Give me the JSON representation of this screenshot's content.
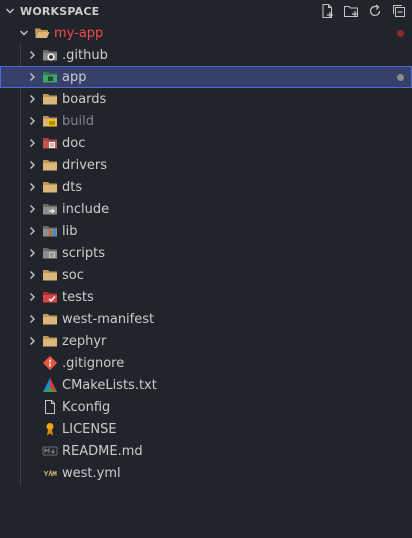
{
  "section": {
    "title": "WORKSPACE",
    "actions": [
      {
        "name": "new-file-icon"
      },
      {
        "name": "new-folder-icon"
      },
      {
        "name": "refresh-icon"
      },
      {
        "name": "collapse-all-icon"
      }
    ]
  },
  "root": {
    "label": "my-app",
    "color": "#f14c4c",
    "status_dot_color": "#8b2a2a"
  },
  "items": [
    {
      "label": ".github",
      "type": "folder",
      "icon": "github-folder-icon"
    },
    {
      "label": "app",
      "type": "folder",
      "icon": "app-folder-icon",
      "selected": true,
      "status_dot_color": "#8c8c8c"
    },
    {
      "label": "boards",
      "type": "folder",
      "icon": "folder-icon"
    },
    {
      "label": "build",
      "type": "folder",
      "icon": "build-folder-icon",
      "dimmed": true
    },
    {
      "label": "doc",
      "type": "folder",
      "icon": "docs-folder-icon"
    },
    {
      "label": "drivers",
      "type": "folder",
      "icon": "folder-icon"
    },
    {
      "label": "dts",
      "type": "folder",
      "icon": "folder-icon"
    },
    {
      "label": "include",
      "type": "folder",
      "icon": "include-folder-icon"
    },
    {
      "label": "lib",
      "type": "folder",
      "icon": "lib-folder-icon"
    },
    {
      "label": "scripts",
      "type": "folder",
      "icon": "scripts-folder-icon"
    },
    {
      "label": "soc",
      "type": "folder",
      "icon": "folder-icon"
    },
    {
      "label": "tests",
      "type": "folder",
      "icon": "tests-folder-icon"
    },
    {
      "label": "west-manifest",
      "type": "folder",
      "icon": "folder-icon"
    },
    {
      "label": "zephyr",
      "type": "folder",
      "icon": "folder-icon"
    },
    {
      "label": ".gitignore",
      "type": "file",
      "icon": "git-icon"
    },
    {
      "label": "CMakeLists.txt",
      "type": "file",
      "icon": "cmake-icon"
    },
    {
      "label": "Kconfig",
      "type": "file",
      "icon": "file-icon"
    },
    {
      "label": "LICENSE",
      "type": "file",
      "icon": "license-icon"
    },
    {
      "label": "README.md",
      "type": "file",
      "icon": "markdown-icon"
    },
    {
      "label": "west.yml",
      "type": "file",
      "icon": "yaml-icon"
    }
  ]
}
